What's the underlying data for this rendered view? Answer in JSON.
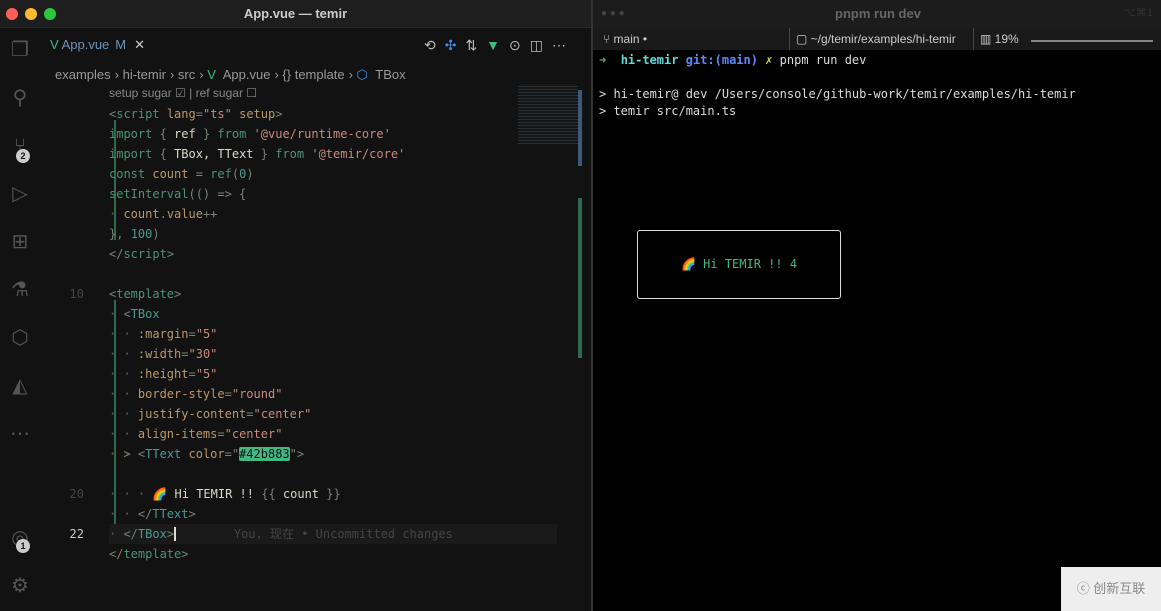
{
  "editor": {
    "window_title": "App.vue — temir",
    "tab": {
      "label": "App.vue",
      "status": "M"
    },
    "breadcrumb": [
      "examples",
      "hi-temir",
      "src",
      "App.vue",
      "{} template",
      "TBox"
    ],
    "codelens": "setup sugar ☑ | ref sugar ☐",
    "line_numbers": {
      "l10": "10",
      "l20": "20",
      "l22": "22"
    },
    "badges": {
      "scm": "2",
      "accounts": "1"
    },
    "blame": "You, 现在 • Uncommitted changes",
    "color_value": "#42b883"
  },
  "terminal": {
    "title": "pnpm run dev",
    "shortcut": "⌥⌘1",
    "branch": "main",
    "path": "~/g/temir/examples/hi-temir",
    "cpu": "19%",
    "prompt_dir": "hi-temir",
    "git": "git:(main)",
    "command": "pnpm run dev",
    "out1": "> hi-temir@ dev /Users/console/github-work/temir/examples/hi-temir",
    "out2": "> temir src/main.ts",
    "render": "🌈 Hi TEMIR !! 4"
  },
  "watermark": "创新互联",
  "colors": {
    "accent": "#42b883"
  }
}
